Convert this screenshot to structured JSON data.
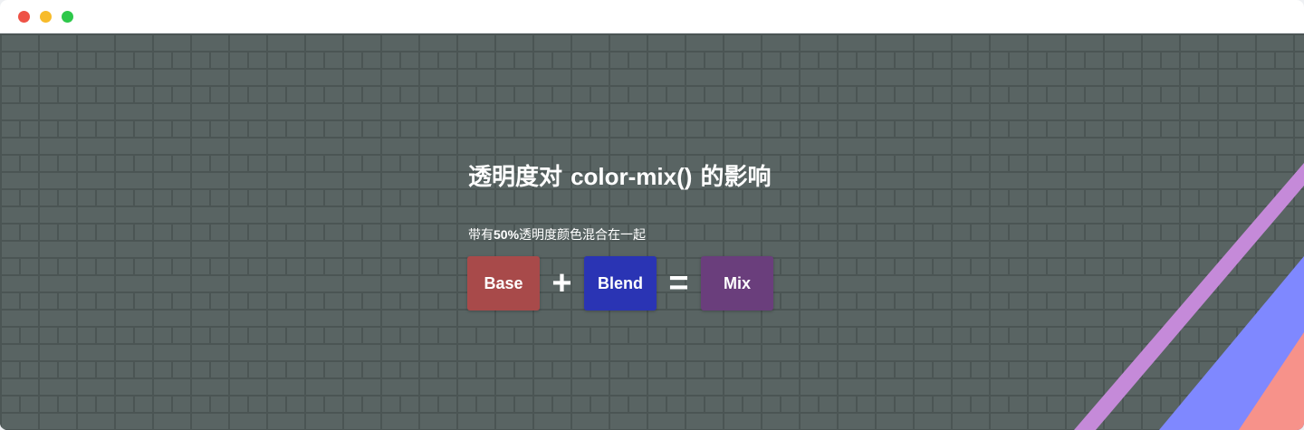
{
  "window": {
    "controls": [
      "close",
      "minimize",
      "maximize"
    ]
  },
  "colors": {
    "close": "#ee5246",
    "minimize": "#f7bb2a",
    "maximize": "#2dc84a",
    "background": "#596463",
    "base": "#a84a4a",
    "blend": "#2a34b4",
    "mix": "#6a3e7c",
    "stripe_purple": "#c58ad9",
    "stripe_blue": "#7f88ff",
    "stripe_salmon": "#f7928a"
  },
  "main": {
    "title_prefix": "透明度对",
    "title_code": "color-mix()",
    "title_suffix": "的影响",
    "subtitle_prefix": "带有",
    "subtitle_percent": "50%",
    "subtitle_suffix": "透明度颜色混合在一起",
    "equation": {
      "base_label": "Base",
      "plus_sign": "+",
      "blend_label": "Blend",
      "equals_sign": "=",
      "mix_label": "Mix"
    }
  }
}
